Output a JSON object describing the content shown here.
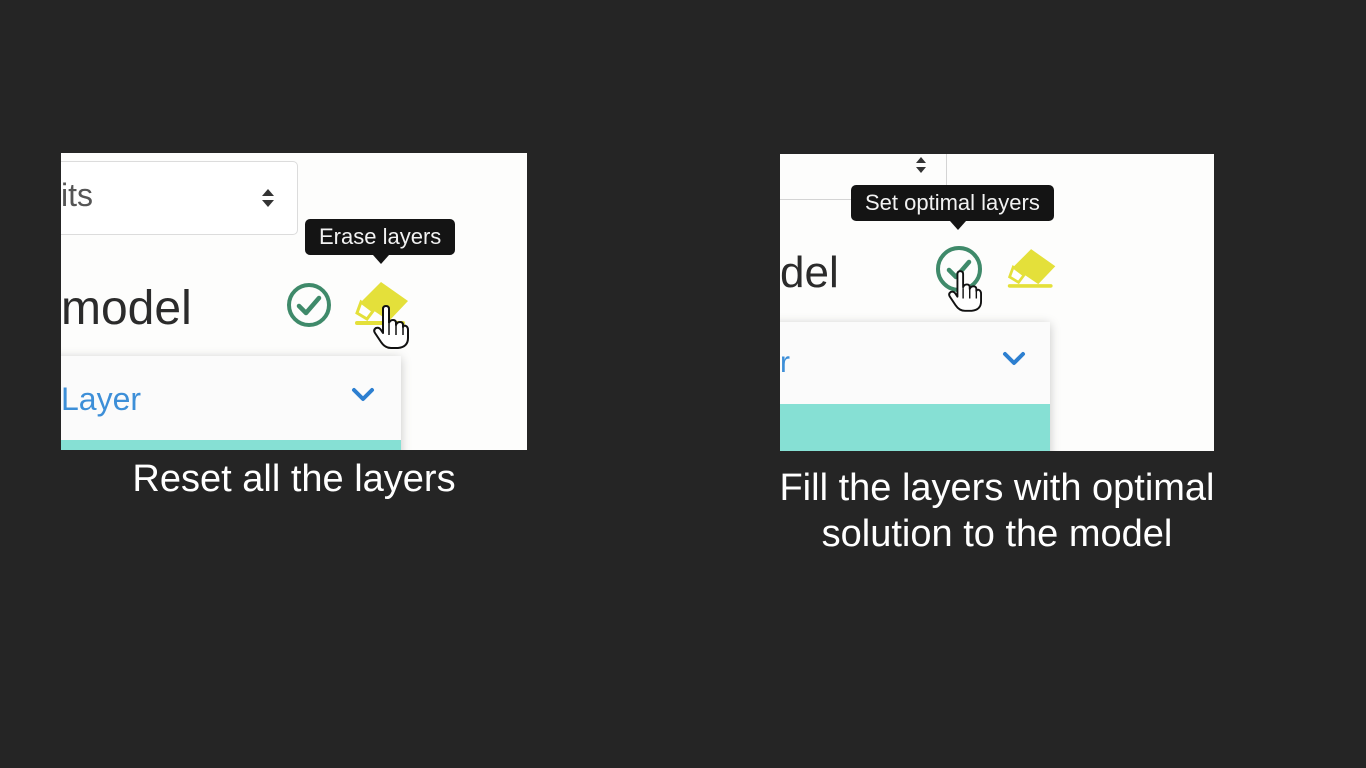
{
  "left_panel": {
    "select_text": "its",
    "model_text": "model",
    "tooltip": "Erase layers",
    "dropdown_label": "Layer",
    "caption": "Reset all the layers",
    "icons": [
      "check-circle-icon",
      "eraser-icon",
      "hand-pointer-icon",
      "sort-arrows-icon",
      "chevron-down-icon"
    ]
  },
  "right_panel": {
    "model_text": "del",
    "tooltip": "Set optimal layers",
    "dropdown_label": "r",
    "caption_line1": "Fill the layers with optimal",
    "caption_line2": "solution to the model",
    "icons": [
      "check-circle-icon",
      "eraser-icon",
      "hand-pointer-icon",
      "sort-arrows-icon",
      "chevron-down-icon"
    ]
  },
  "colors": {
    "background": "#252525",
    "check_green": "#3f8a6a",
    "eraser_yellow": "#e4e03a",
    "link_blue": "#3d8fd8",
    "teal": "#86e0d4",
    "tooltip_bg": "#141414"
  }
}
